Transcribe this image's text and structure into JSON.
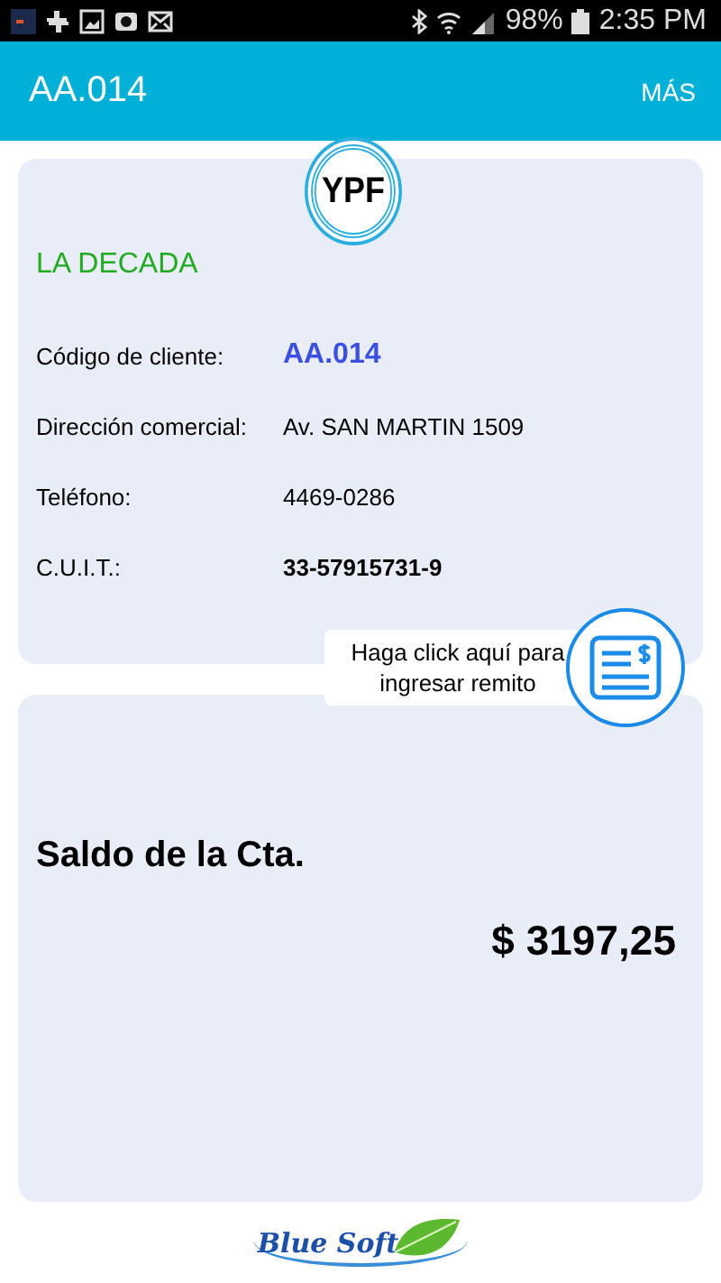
{
  "status_bar": {
    "battery": "98%",
    "time": "2:35 PM"
  },
  "app_bar": {
    "title": "AA.014",
    "menu": "MÁS"
  },
  "client_card": {
    "logo": "YPF",
    "name": "LA DECADA",
    "fields": [
      {
        "label": "Código de cliente:",
        "value": "AA.014",
        "kind": "code"
      },
      {
        "label": "Dirección comercial:",
        "value": "Av. SAN MARTIN 1509",
        "kind": "plain"
      },
      {
        "label": "Teléfono:",
        "value": "4469-0286",
        "kind": "plain"
      },
      {
        "label": "C.U.I.T.:",
        "value": "33-57915731-9",
        "kind": "bold"
      }
    ]
  },
  "remito_button": {
    "hint": "Haga click aquí para ingresar remito"
  },
  "balance_card": {
    "label": "Saldo de la Cta.",
    "amount": "$ 3197,25"
  },
  "footer": {
    "brand": "Blue Soft"
  }
}
